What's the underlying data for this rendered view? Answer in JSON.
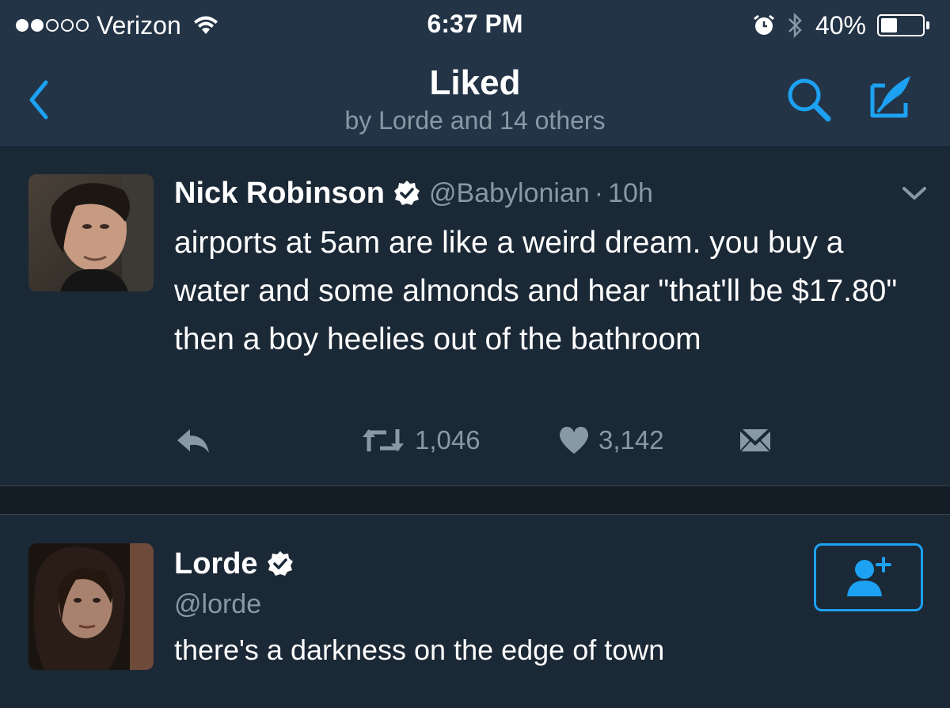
{
  "status_bar": {
    "carrier": "Verizon",
    "time": "6:37 PM",
    "battery_percent": "40%",
    "battery_level": 0.4,
    "signal_bars_filled": 2,
    "signal_bars_total": 5,
    "icons": [
      "wifi-icon",
      "alarm-icon",
      "bluetooth-icon",
      "battery-icon"
    ]
  },
  "nav": {
    "title": "Liked",
    "subtitle": "by Lorde and 14 others",
    "icons": [
      "back-chevron-icon",
      "search-icon",
      "compose-icon"
    ]
  },
  "tweet": {
    "display_name": "Nick Robinson",
    "handle": "@Babylonian",
    "separator": "·",
    "time": "10h",
    "verified": true,
    "text": "airports at 5am are like a weird dream. you buy a water and some almonds and hear \"that'll be $17.80\" then a boy heelies out of the bathroom",
    "retweets": "1,046",
    "likes": "3,142",
    "action_icons": [
      "reply-icon",
      "retweet-icon",
      "heart-icon",
      "dm-icon"
    ]
  },
  "user": {
    "display_name": "Lorde",
    "handle": "@lorde",
    "verified": true,
    "bio": "there's a darkness on the edge of town",
    "follow_icon": "follow-user-icon"
  },
  "colors": {
    "background": "#1b2836",
    "header": "#243447",
    "accent": "#1da1f2",
    "secondary_text": "#8899a6",
    "band": "#141d26"
  }
}
